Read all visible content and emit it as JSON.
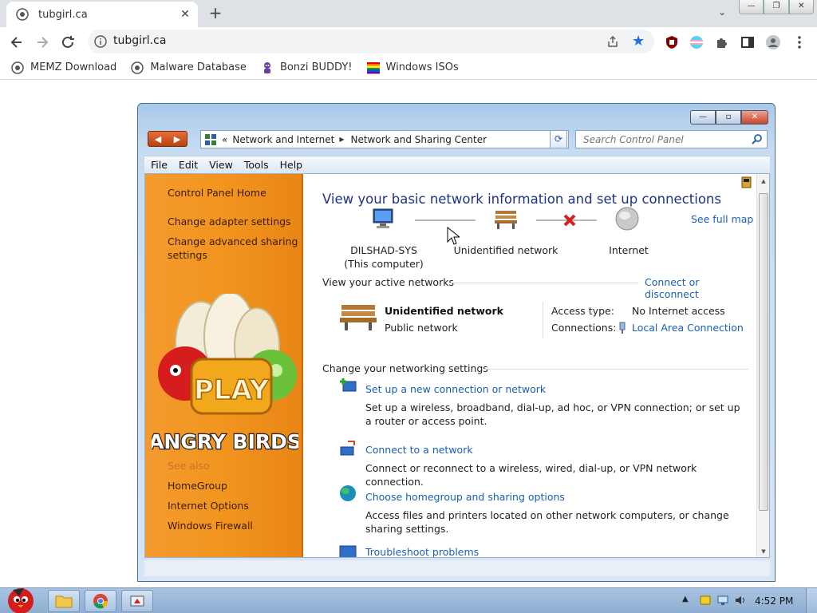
{
  "browser": {
    "tab": {
      "title": "tubgirl.ca",
      "close": "✕"
    },
    "new_tab": "+",
    "tab_search": "⌄",
    "window_buttons": {
      "minimize": "—",
      "restore": "❐",
      "close": "✕"
    },
    "omnibox": {
      "url": "tubgirl.ca"
    },
    "bookmarks": [
      {
        "label": "MEMZ Download"
      },
      {
        "label": "Malware Database"
      },
      {
        "label": "Bonzi BUDDY!"
      },
      {
        "label": "Windows ISOs"
      }
    ],
    "accent": "#1a73e8"
  },
  "control_panel": {
    "window_buttons": {
      "minimize": "—",
      "maximize": "▫",
      "close": "✕"
    },
    "breadcrumb": {
      "prefix": "«",
      "segments": [
        "Network and Internet",
        "Network and Sharing Center"
      ],
      "arrow": "▶"
    },
    "search": {
      "placeholder": "Search Control Panel"
    },
    "menu": [
      "File",
      "Edit",
      "View",
      "Tools",
      "Help"
    ],
    "sidebar": {
      "home": "Control Panel Home",
      "links": [
        "Change adapter settings",
        "Change advanced sharing",
        "settings"
      ],
      "see_also_obscured": "See also",
      "see_also": [
        "HomeGroup",
        "Internet Options",
        "Windows Firewall"
      ],
      "game": {
        "play": "PLAY",
        "title": "ANGRY BIRDS"
      }
    },
    "main": {
      "heading": "View your basic network information and set up connections",
      "see_full_map": "See full map",
      "map": {
        "computer_name": "DILSHAD-SYS",
        "computer_sub": "(This computer)",
        "network": "Unidentified network",
        "internet": "Internet"
      },
      "active_title": "View your active networks",
      "connect_link": "Connect or disconnect",
      "active_network": {
        "name": "Unidentified network",
        "type": "Public network",
        "access_label": "Access type:",
        "access_value": "No Internet access",
        "connections_label": "Connections:",
        "connections_value": "Local Area Connection"
      },
      "settings_title": "Change your networking settings",
      "tasks": [
        {
          "link": "Set up a new connection or network",
          "desc": "Set up a wireless, broadband, dial-up, ad hoc, or VPN connection; or set up a router or access point."
        },
        {
          "link": "Connect to a network",
          "desc": "Connect or reconnect to a wireless, wired, dial-up, or VPN network connection."
        },
        {
          "link": "Choose homegroup and sharing options",
          "desc": "Access files and printers located on other network computers, or change sharing settings."
        },
        {
          "link": "Troubleshoot problems"
        }
      ]
    }
  },
  "taskbar": {
    "clock": "4:52 PM"
  }
}
